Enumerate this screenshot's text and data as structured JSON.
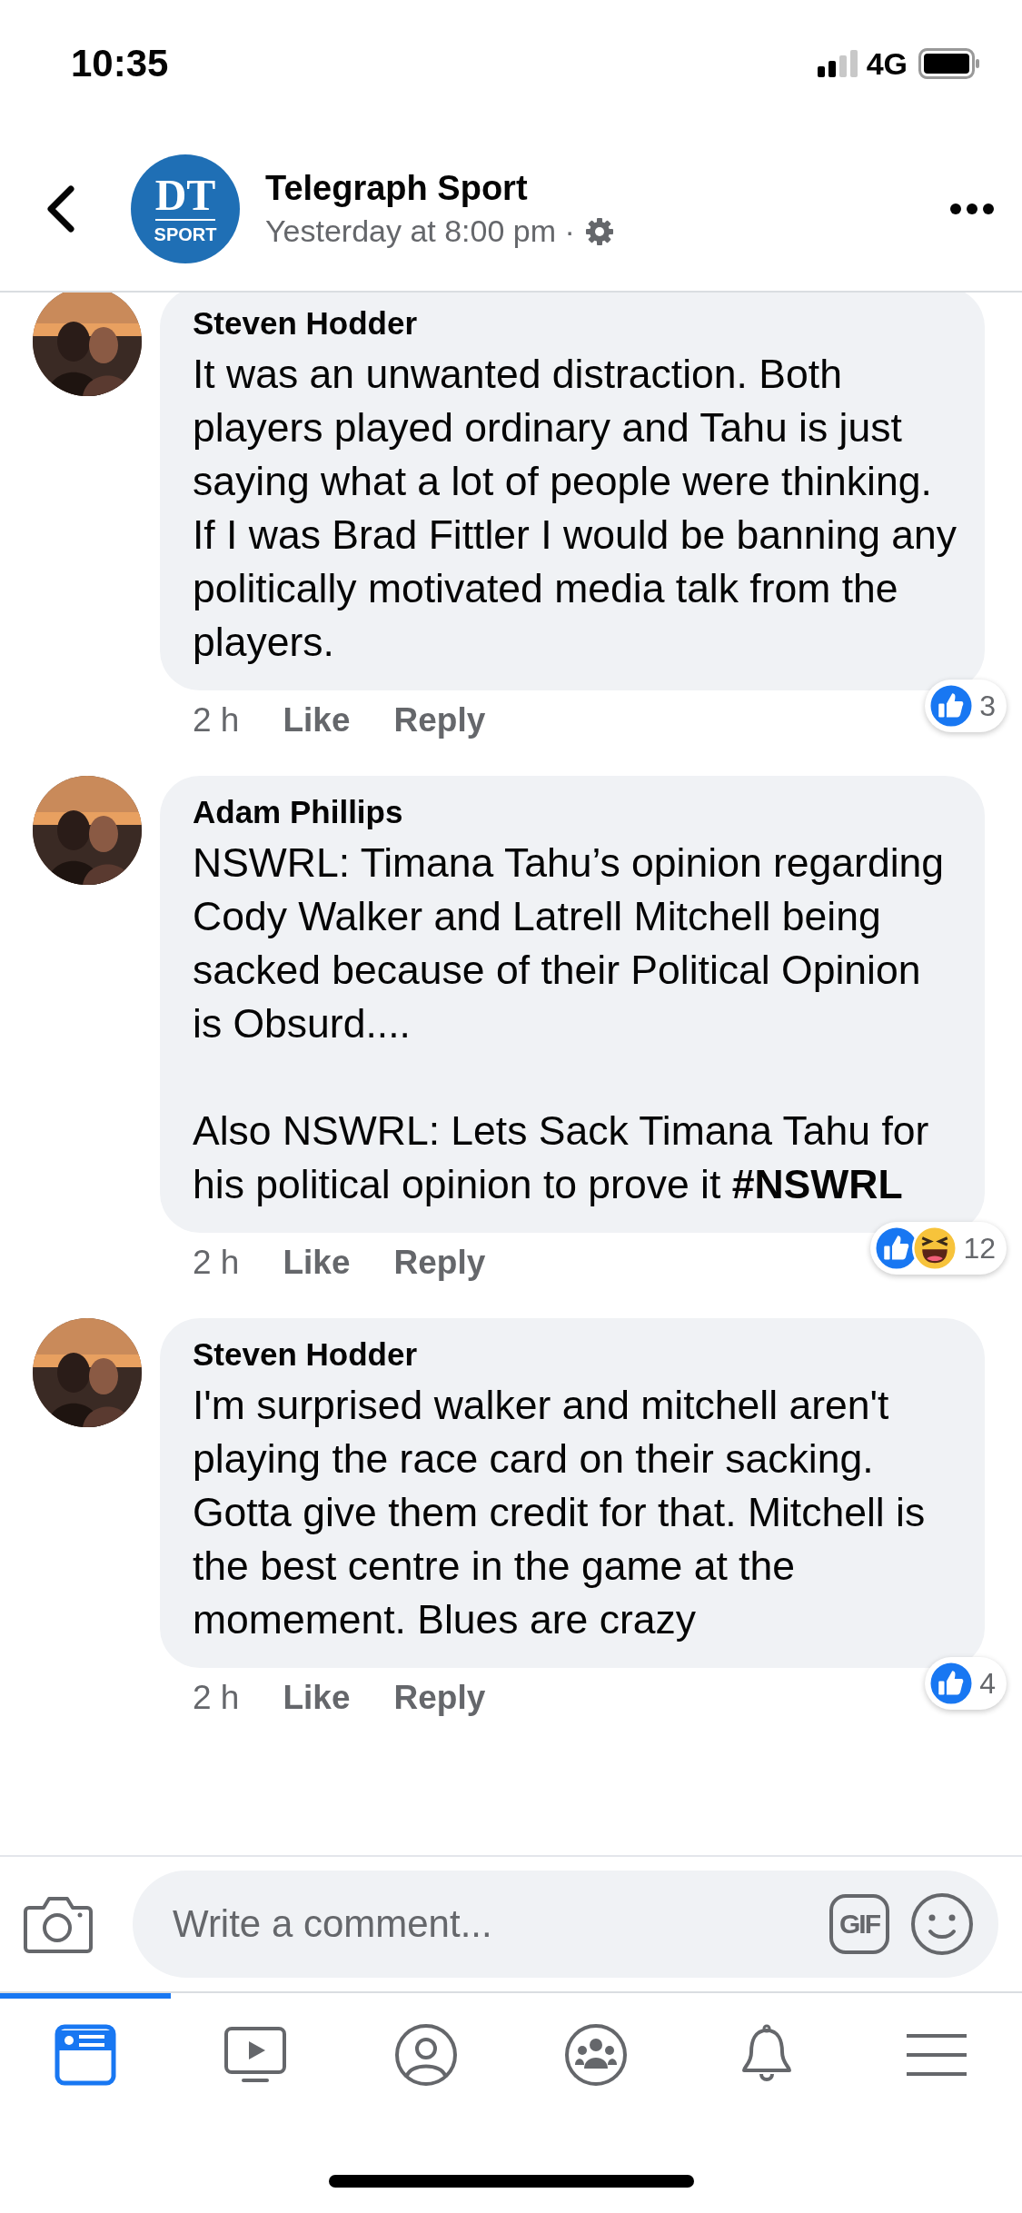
{
  "status_bar": {
    "time": "10:35",
    "network": "4G"
  },
  "header": {
    "logo": {
      "top": "DT",
      "bottom": "SPORT"
    },
    "title": "Telegraph Sport",
    "subtitle": "Yesterday at 8:00 pm ·"
  },
  "comments": [
    {
      "author": "Steven Hodder",
      "paragraphs": [
        "It was an unwanted distraction. Both players played ordinary and Tahu is just saying what a lot of people were thinking. If I was Brad Fittler I would be banning any politically motivated media talk from the players."
      ],
      "time": "2 h",
      "actions": [
        "Like",
        "Reply"
      ],
      "reactions": [
        {
          "kind": "like"
        }
      ],
      "count": "3"
    },
    {
      "author": "Adam Phillips",
      "paragraphs": [
        "NSWRL: Timana Tahu’s opinion regarding Cody Walker and Latrell Mitchell being sacked because of their Political Opinion is Obsurd....",
        "Also NSWRL: Lets Sack Timana Tahu for his political opinion to prove it **#NSWRL**"
      ],
      "time": "2 h",
      "actions": [
        "Like",
        "Reply"
      ],
      "reactions": [
        {
          "kind": "like"
        },
        {
          "kind": "haha"
        }
      ],
      "count": "12"
    },
    {
      "author": "Steven Hodder",
      "paragraphs": [
        "I'm surprised walker and mitchell aren't playing the race card on their sacking. Gotta give them credit for that. Mitchell is the best centre in the game at the momement.  Blues are crazy"
      ],
      "time": "2 h",
      "actions": [
        "Like",
        "Reply"
      ],
      "reactions": [
        {
          "kind": "like"
        }
      ],
      "count": "4"
    }
  ],
  "composer": {
    "placeholder": "Write a comment...",
    "gif": "GIF"
  },
  "tabs": [
    {
      "kind": "feed",
      "selected": true
    },
    {
      "kind": "video",
      "selected": false
    },
    {
      "kind": "profile",
      "selected": false
    },
    {
      "kind": "groups",
      "selected": false
    },
    {
      "kind": "bell",
      "selected": false
    },
    {
      "kind": "menu",
      "selected": false
    }
  ]
}
